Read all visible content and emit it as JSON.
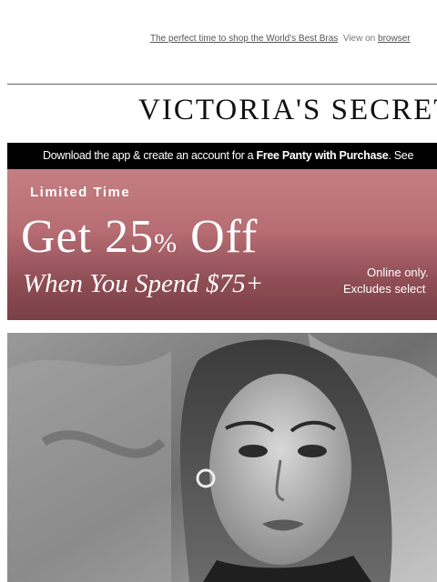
{
  "preheader": {
    "text": "The perfect time to shop the World's Best Bras",
    "view_on": "View on",
    "browser_link": "browser"
  },
  "brand": {
    "logo": "VICTORIA'S SECRET"
  },
  "app_banner": {
    "prefix": "Download the app & create an account for a ",
    "bold": "Free Panty with Purchase",
    "suffix": ". See"
  },
  "promo": {
    "label": "Limited Time",
    "headline_start": "Get 25",
    "headline_pct": "%",
    "headline_end": " Off",
    "subhead": "When You Spend $75+",
    "fine_print_1": "Online only.",
    "fine_print_2": "Excludes select",
    "colors": {
      "top": "#c47f83",
      "bottom": "#7a3f47"
    }
  },
  "hero": {
    "image": "model-portrait-black-and-white"
  }
}
